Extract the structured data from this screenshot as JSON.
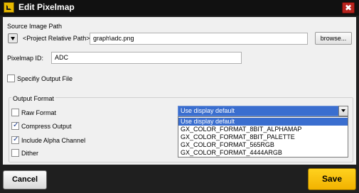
{
  "window": {
    "title": "Edit Pixelmap",
    "close_glyph": "✖"
  },
  "source": {
    "label": "Source Image Path",
    "path_prefix": "<Project Relative Path>",
    "path_value": "graph\\adc.png",
    "browse_label": "browse..."
  },
  "pixelmap": {
    "id_label": "Pixelmap ID:",
    "id_value": "ADC"
  },
  "specify_output": {
    "label": "Specifiy Output File",
    "checked": false
  },
  "output_format": {
    "label": "Output Format",
    "options": [
      {
        "label": "Raw Format",
        "checked": false
      },
      {
        "label": "Compress Output",
        "checked": true
      },
      {
        "label": "Include Alpha Channel",
        "checked": true
      },
      {
        "label": "Dither",
        "checked": false
      }
    ],
    "color_format": {
      "selected": "Use display default",
      "items": [
        "Use display default",
        "GX_COLOR_FORMAT_8BIT_ALPHAMAP",
        "GX_COLOR_FORMAT_8BIT_PALETTE",
        "GX_COLOR_FORMAT_565RGB",
        "GX_COLOR_FORMAT_4444ARGB"
      ]
    }
  },
  "footer": {
    "cancel_label": "Cancel",
    "save_label": "Save"
  },
  "colors": {
    "accent": "#3a6ecf",
    "save": "#f5b800",
    "title_bar": "#111111",
    "close": "#b8231e"
  }
}
